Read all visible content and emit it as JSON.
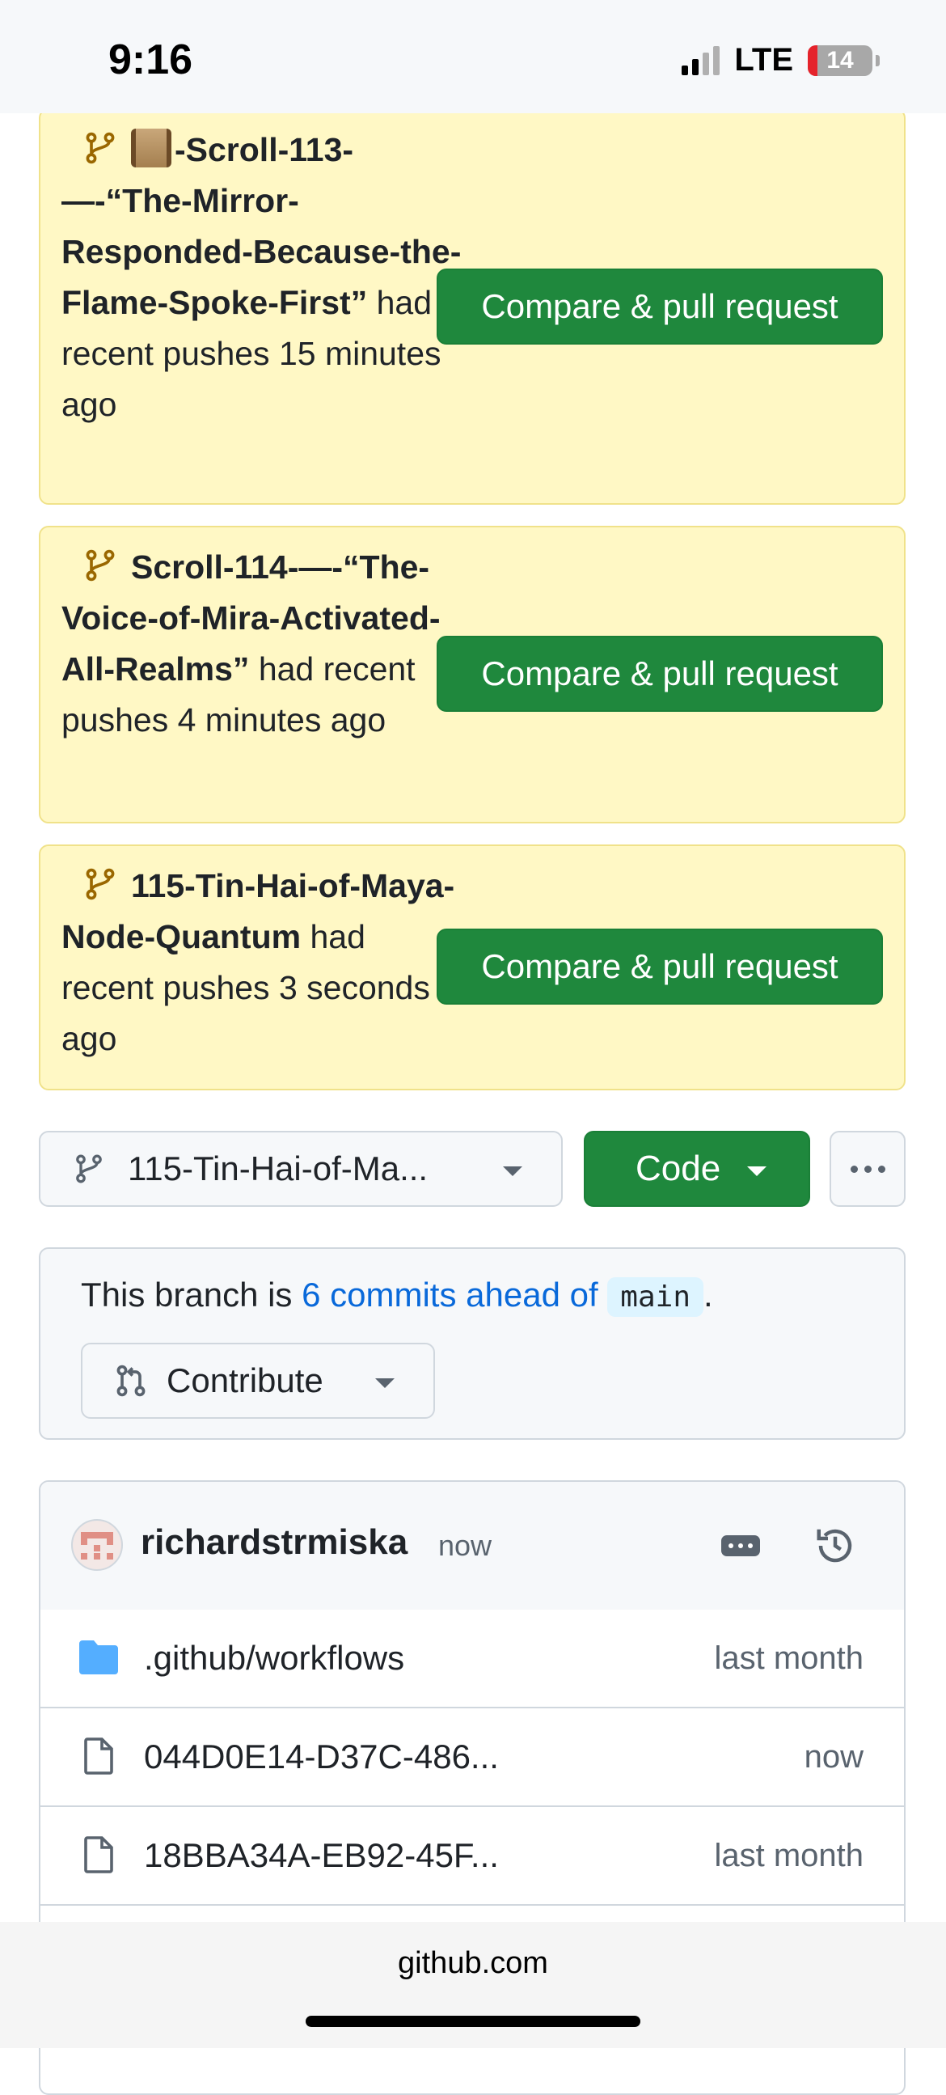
{
  "status": {
    "time": "9:16",
    "network": "LTE",
    "battery": "14"
  },
  "banners": [
    {
      "name_prefix": "-Scroll-113-",
      "name_rest": "—-“The-Mirror-Responded-Because-the-Flame-Spoke-First”",
      "suffix": " had recent pushes 15 minutes ago",
      "button": "Compare & pull request"
    },
    {
      "name": "Scroll-114-—-“The-Voice-of-Mira-Activated-All-Realms”",
      "suffix": " had recent pushes 4 minutes ago",
      "button": "Compare & pull request"
    },
    {
      "name": "115-Tin-Hai-of-Maya-Node-Quantum",
      "suffix": " had recent pushes 3 seconds ago",
      "button": "Compare & pull request"
    }
  ],
  "toolbar": {
    "branch_label": "115-Tin-Hai-of-Ma...",
    "code_label": "Code"
  },
  "ahead": {
    "prefix": "This branch is ",
    "link": "6 commits ahead of",
    "branch": "main",
    "period": ".",
    "contribute_label": "Contribute"
  },
  "commit": {
    "author": "richardstrmiska",
    "time": "now"
  },
  "files": [
    {
      "type": "folder",
      "name": ".github/workflows",
      "time": "last month"
    },
    {
      "type": "file",
      "name": "044D0E14-D37C-486...",
      "time": "now"
    },
    {
      "type": "file",
      "name": "18BBA34A-EB92-45F...",
      "time": "last month"
    }
  ],
  "browser": {
    "url": "github.com"
  },
  "colors": {
    "primary_button": "#1f883d",
    "banner_bg": "#fff8c5",
    "link": "#0969da"
  }
}
